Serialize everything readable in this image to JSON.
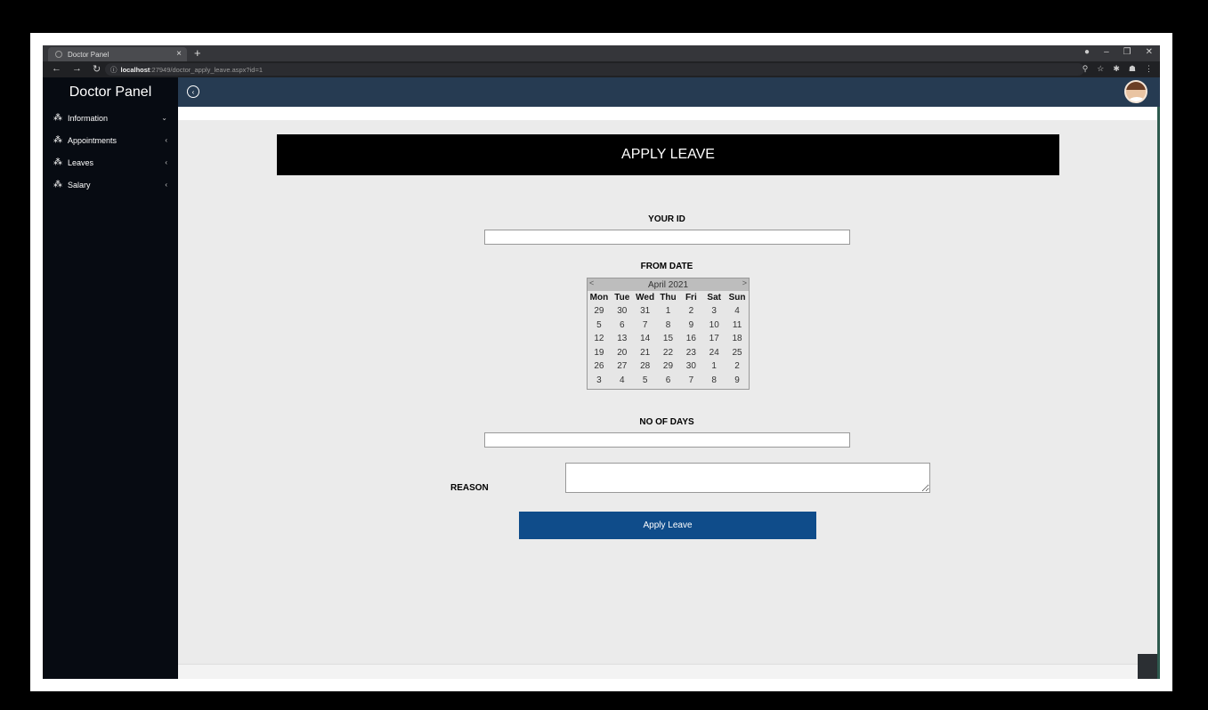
{
  "browser": {
    "tab_title": "Doctor Panel",
    "tab_close": "×",
    "new_tab": "+",
    "url_host": "localhost",
    "url_path": ":27949/doctor_apply_leave.aspx?id=1"
  },
  "sidebar": {
    "brand": "Doctor Panel",
    "items": [
      {
        "label": "Information",
        "chevron": "⌄"
      },
      {
        "label": "Appointments",
        "chevron": "‹"
      },
      {
        "label": "Leaves",
        "chevron": "‹"
      },
      {
        "label": "Salary",
        "chevron": "‹"
      }
    ]
  },
  "main": {
    "banner": "APPLY LEAVE",
    "your_id_label": "YOUR ID",
    "your_id_value": "",
    "from_date_label": "FROM DATE",
    "no_of_days_label": "NO OF DAYS",
    "no_of_days_value": "",
    "reason_label": "REASON",
    "reason_value": "",
    "apply_button": "Apply Leave"
  },
  "calendar": {
    "month_label": "April 2021",
    "prev": "<",
    "next": ">",
    "days_of_week": [
      "Mon",
      "Tue",
      "Wed",
      "Thu",
      "Fri",
      "Sat",
      "Sun"
    ],
    "weeks": [
      [
        "29",
        "30",
        "31",
        "1",
        "2",
        "3",
        "4"
      ],
      [
        "5",
        "6",
        "7",
        "8",
        "9",
        "10",
        "11"
      ],
      [
        "12",
        "13",
        "14",
        "15",
        "16",
        "17",
        "18"
      ],
      [
        "19",
        "20",
        "21",
        "22",
        "23",
        "24",
        "25"
      ],
      [
        "26",
        "27",
        "28",
        "29",
        "30",
        "1",
        "2"
      ],
      [
        "3",
        "4",
        "5",
        "6",
        "7",
        "8",
        "9"
      ]
    ]
  },
  "colors": {
    "sidebar_bg": "#070b12",
    "topbar_bg": "#263b52",
    "button_bg": "#0f4c8a",
    "content_bg": "#ebebeb"
  }
}
